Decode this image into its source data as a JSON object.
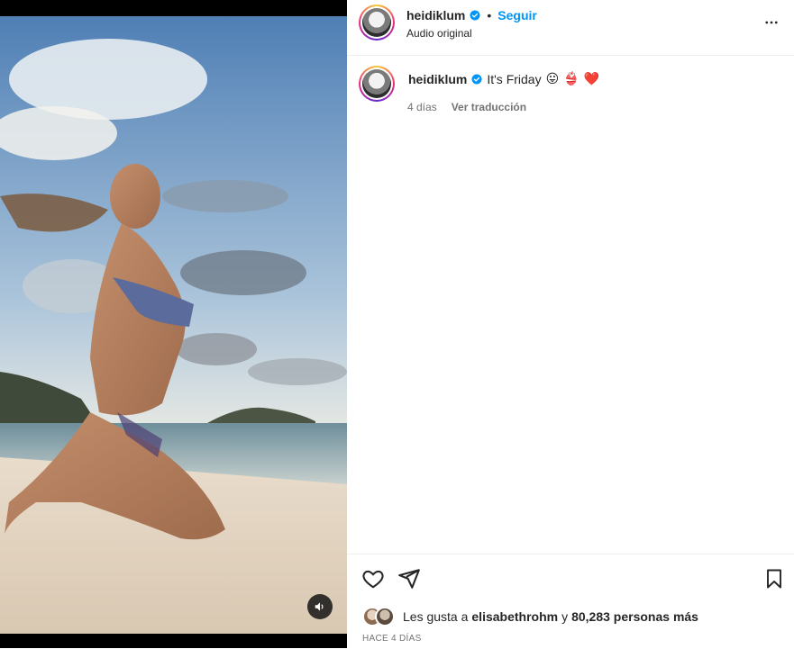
{
  "post": {
    "username": "heidiklum",
    "follow_label": "Seguir",
    "audio": "Audio original",
    "caption_text": "It's Friday",
    "caption_emojis": [
      "😛",
      "👙",
      "❤️"
    ],
    "time_ago": "4 días",
    "translate_label": "Ver traducción"
  },
  "likes": {
    "prefix": "Les gusta a",
    "user": "elisabethrohm",
    "joiner": "y",
    "count_text": "80,283 personas más"
  },
  "date_label": "HACE 4 DÍAS",
  "icons": {
    "verified": "verified-badge-icon",
    "more": "more-options-icon",
    "like": "heart-icon",
    "share": "send-icon",
    "save": "bookmark-icon",
    "sound": "speaker-icon"
  },
  "colors": {
    "accent": "#0095f6",
    "verified": "#0095f6",
    "text": "#262626",
    "muted": "#737373"
  }
}
